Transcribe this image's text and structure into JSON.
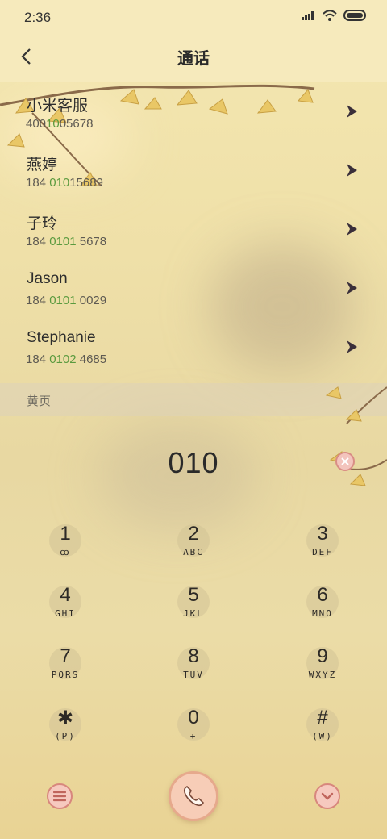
{
  "status_bar": {
    "time": "2:36",
    "icons": [
      "signal-icon",
      "wifi-icon",
      "battery-icon"
    ]
  },
  "header": {
    "title": "通话",
    "back_icon": "chevron-left-icon"
  },
  "contacts": [
    {
      "name": "小米客服",
      "num_pre": "400",
      "num_hl": "10",
      "num_post": "05678"
    },
    {
      "name": "燕婷",
      "num_pre": "184 ",
      "num_hl": "010",
      "num_post": "15689"
    },
    {
      "name": "子玲",
      "num_pre": "184 ",
      "num_hl": "0101",
      "num_post": " 5678"
    },
    {
      "name": "Jason",
      "num_pre": "184 ",
      "num_hl": "0101",
      "num_post": " 0029"
    },
    {
      "name": "Stephanie",
      "num_pre": "184 ",
      "num_hl": "0102",
      "num_post": " 4685"
    }
  ],
  "yellow_pages": {
    "label": "黄页"
  },
  "dialer": {
    "number": "010",
    "keys": [
      {
        "digit": "1",
        "letters": "ꝏ"
      },
      {
        "digit": "2",
        "letters": "ABC"
      },
      {
        "digit": "3",
        "letters": "DEF"
      },
      {
        "digit": "4",
        "letters": "GHI"
      },
      {
        "digit": "5",
        "letters": "JKL"
      },
      {
        "digit": "6",
        "letters": "MNO"
      },
      {
        "digit": "7",
        "letters": "PQRS"
      },
      {
        "digit": "8",
        "letters": "TUV"
      },
      {
        "digit": "9",
        "letters": "WXYZ"
      },
      {
        "digit": "✱",
        "letters": "(P)"
      },
      {
        "digit": "0",
        "letters": "+"
      },
      {
        "digit": "#",
        "letters": "(W)"
      }
    ]
  },
  "colors": {
    "highlight": "#5a9a3e",
    "accent": "#d8877d",
    "background": "#efe0a8"
  }
}
